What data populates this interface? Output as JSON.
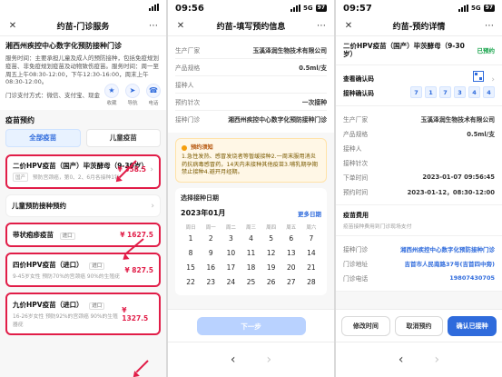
{
  "phone1": {
    "status": {
      "time": "",
      "network": "",
      "battery": ""
    },
    "nav": {
      "title": "约苗-门诊服务"
    },
    "hero": {
      "clinic_name": "湘西州疾控中心数字化预防接种门诊",
      "desc": "服务时间：主要承担儿童及成人的预防接种，包括免疫规划疫苗、非免疫规划疫苗及动物致伤疫苗。服务时间：周一至周五上午08:30-12:00，下午12:30-16:00，周末上午08:30-12:00。",
      "pay": "门诊支付方式：微信、支付宝、现金",
      "icons": [
        {
          "label": "收藏",
          "name": "favorite"
        },
        {
          "label": "导航",
          "name": "navigate"
        },
        {
          "label": "电话",
          "name": "phone"
        }
      ]
    },
    "section_title": "疫苗预约",
    "tabs": {
      "all": "全部疫苗",
      "child": "儿童疫苗"
    },
    "vaccines": {
      "hpv2": {
        "title": "二价HPV疫苗（国产）毕茨酵母（9-30岁）",
        "tag": "国产",
        "price": "¥ 358.5",
        "sub": "预防宫颈癌，第0、2、6月各接种1针"
      },
      "child_plan": {
        "label": "儿童预防接种预约"
      },
      "shingles": {
        "label": "带状疱疹疫苗",
        "tag": "进口",
        "price": "¥ 1627.5"
      },
      "hpv4": {
        "label": "四价HPV疫苗（进口）",
        "tag": "进口",
        "price": "¥ 827.5",
        "sub": "9-45岁女性 预防70%的宫颈癌 90%的生殖疣"
      },
      "hpv9": {
        "label": "九价HPV疫苗（进口）",
        "tag": "进口",
        "price": "¥ 1327.5",
        "sub": "16-26岁女性 预防92%的宫颈癌 90%的生殖器疣"
      }
    }
  },
  "phone2": {
    "status": {
      "time": "09:56",
      "network": "5G",
      "battery": "97"
    },
    "nav": {
      "title": "约苗-填写预约信息"
    },
    "form": {
      "maker_k": "生产厂家",
      "maker_v": "玉溪泽润生物技术有限公司",
      "spec_k": "产品规格",
      "spec_v": "0.5ml/支",
      "person_k": "接种人",
      "person_v": "",
      "times_k": "预约针次",
      "times_v": "一次接种",
      "clinic_k": "接种门诊",
      "clinic_v": "湘西州疾控中心数字化预防接种门诊"
    },
    "notice": {
      "title": "预约须知",
      "body": "1.急性发热、感冒发烧者等暂缓接种2.一周末服用消炎药抗病毒感冒药，14天内未接种其他疫苗3.哺乳期孕期禁止接种4.避开月经期。"
    },
    "date": {
      "title": "选择接种日期",
      "month": "2023年01月",
      "more": "更多日期",
      "week": [
        "周日",
        "周一",
        "周二",
        "周三",
        "周四",
        "周五",
        "周六"
      ],
      "days": [
        "1",
        "2",
        "3",
        "4",
        "5",
        "6",
        "7",
        "8",
        "9",
        "10",
        "11",
        "12",
        "13",
        "14",
        "15",
        "16",
        "17",
        "18",
        "19",
        "20",
        "21",
        "22",
        "23",
        "24",
        "25",
        "26",
        "27",
        "28"
      ]
    },
    "next_button": "下一步",
    "bottom": {
      "back": "‹",
      "forward": "›"
    }
  },
  "phone3": {
    "status": {
      "time": "09:57",
      "network": "5G",
      "battery": "97"
    },
    "nav": {
      "title": "约苗-预约详情"
    },
    "vaccine_title": "二价HPV疫苗（国产）毕茨酵母（9-30岁）",
    "status_text": "已预约",
    "query_label": "查看确认码",
    "confirm_label": "接种确认码",
    "confirm_digits": [
      "7",
      "1",
      "7",
      "3",
      "4",
      "4"
    ],
    "details": {
      "maker_k": "生产厂家",
      "maker_v": "玉溪泽润生物技术有限公司",
      "spec_k": "产品规格",
      "spec_v": "0.5ml/支",
      "person_k": "接种人",
      "person_v": "",
      "times_k": "接种针次",
      "times_v": "",
      "order_time_k": "下单时间",
      "order_time_v": "2023-01-07 09:56:45",
      "appt_time_k": "预约时间",
      "appt_time_v": "2023-01-12，08:30-12:00"
    },
    "fee": {
      "title": "疫苗费用",
      "sub": "疫苗接种费用到门诊现场支付"
    },
    "clinic": {
      "clinic_k": "接种门诊",
      "clinic_v": "湘西州疾控中心数字化预防接种门诊",
      "addr_k": "门诊地址",
      "addr_v": "吉首市人民南路37号(吉首四中旁)",
      "tel_k": "门诊电话",
      "tel_v": "19807430705"
    },
    "actions": {
      "modify": "修改时间",
      "cancel": "取消预约",
      "confirm": "确认已接种"
    },
    "bottom": {
      "back": "‹",
      "forward": "›"
    }
  }
}
